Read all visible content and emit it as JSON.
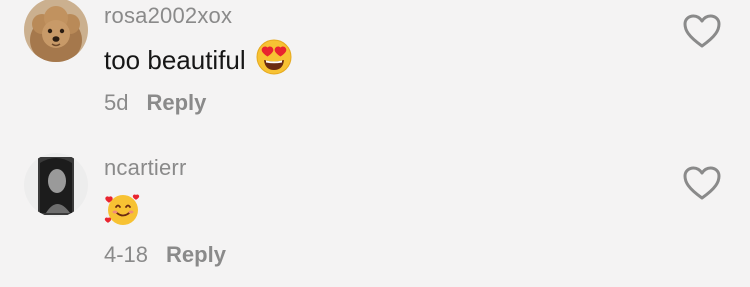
{
  "comments": [
    {
      "username": "rosa2002xox",
      "text": "too beautiful",
      "emoji": "heart-eyes-emoji",
      "time": "5d",
      "reply_label": "Reply",
      "avatar": "dog-avatar"
    },
    {
      "username": "ncartierr",
      "text": "",
      "emoji": "smiling-face-with-hearts-emoji",
      "time": "4-18",
      "reply_label": "Reply",
      "avatar": "person-avatar"
    }
  ],
  "colors": {
    "background": "#f4f3f3",
    "username": "#8a8a8a",
    "text": "#161616",
    "icon": "#8a8a8a"
  },
  "icons": {
    "like": "heart-outline-icon"
  }
}
